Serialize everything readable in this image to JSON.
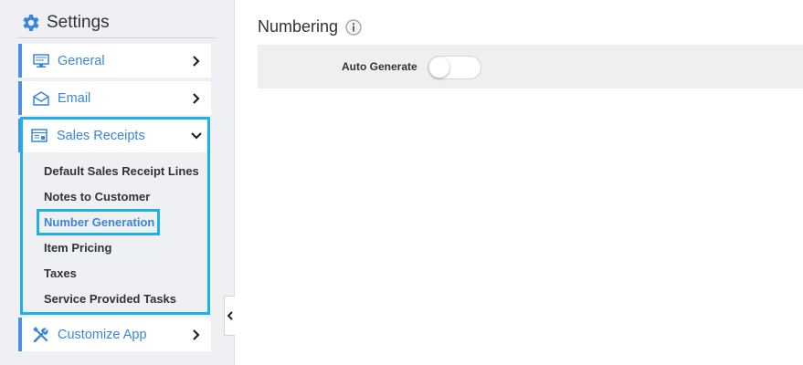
{
  "sidebar": {
    "title": "Settings",
    "items": [
      {
        "label": "General",
        "icon": "monitor-icon"
      },
      {
        "label": "Email",
        "icon": "envelope-icon"
      },
      {
        "label": "Sales Receipts",
        "icon": "receipt-icon"
      },
      {
        "label": "Customize App",
        "icon": "tools-icon"
      }
    ],
    "sales_subitems": [
      "Default Sales Receipt Lines",
      "Notes to Customer",
      "Number Generation",
      "Item Pricing",
      "Taxes",
      "Service Provided Tasks"
    ]
  },
  "main": {
    "section_title": "Numbering",
    "setting": {
      "label": "Auto Generate",
      "toggle_on": false
    }
  },
  "colors": {
    "accent": "#3b86d8",
    "highlight": "#1eb0e6",
    "sidebar_bg": "#eef0f3"
  }
}
